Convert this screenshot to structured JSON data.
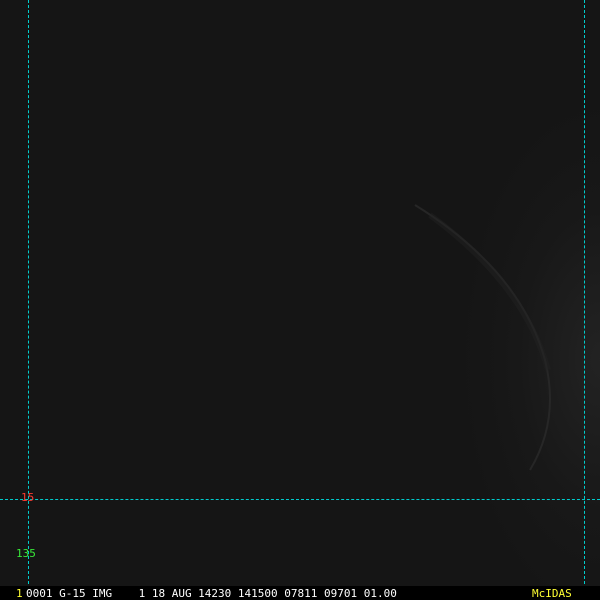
{
  "colors": {
    "cursor": "#00cccc",
    "lat_label": "#ff3b30",
    "lon_label": "#39e639",
    "frame_num": "#ffff33",
    "status_text": "#ffffff",
    "brand": "#ffff33"
  },
  "overlay": {
    "lat_label": "15",
    "lon_label": "135"
  },
  "status_bar": {
    "frame_number": "1",
    "text": "0001 G-15 IMG    1 18 AUG 14230 141500 07811 09701 01.00",
    "brand": "McIDAS"
  }
}
